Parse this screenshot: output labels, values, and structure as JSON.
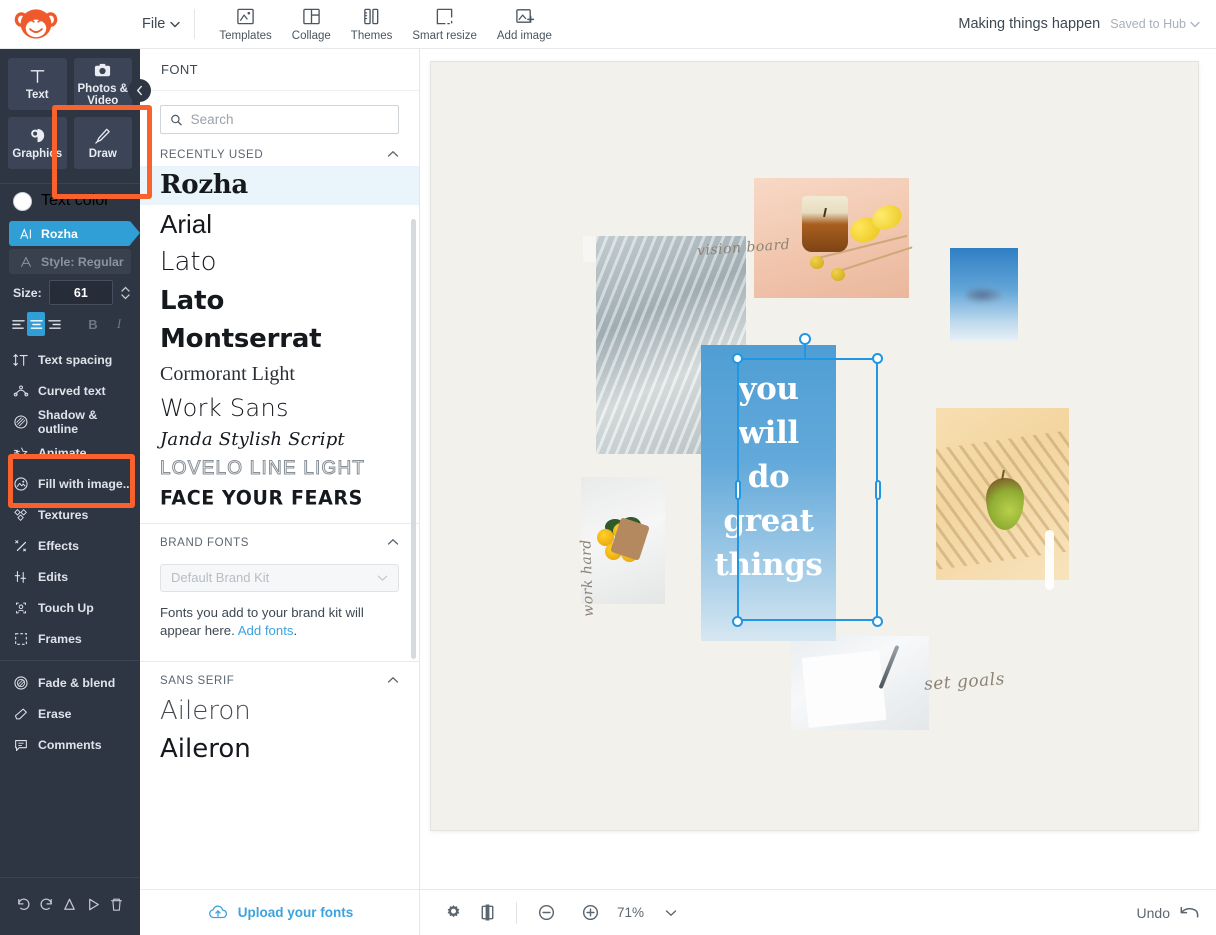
{
  "topbar": {
    "logo": "picmonkey-monkey-logo",
    "file_menu": "File",
    "tools": [
      {
        "label": "Templates",
        "icon": "templates-icon"
      },
      {
        "label": "Collage",
        "icon": "collage-icon"
      },
      {
        "label": "Themes",
        "icon": "themes-icon"
      },
      {
        "label": "Smart resize",
        "icon": "smart-resize-icon"
      },
      {
        "label": "Add image",
        "icon": "add-image-icon"
      }
    ],
    "doc_title": "Making things happen",
    "save_status": "Saved to Hub"
  },
  "rail": {
    "cards": [
      {
        "label": "Text",
        "icon": "text-icon"
      },
      {
        "label": "Photos & Video",
        "icon": "camera-icon"
      },
      {
        "label": "Graphics",
        "icon": "graphics-icon"
      },
      {
        "label": "Draw",
        "icon": "draw-pen-icon"
      }
    ],
    "text_color_label": "Text color",
    "text_color_value": "#ffffff",
    "font_pill": "Rozha",
    "style_pill": "Style: Regular",
    "size_label": "Size:",
    "size_value": "61",
    "align_selected": "center",
    "bold_label": "B",
    "italic_label": "I",
    "menu": [
      {
        "label": "Text spacing",
        "icon": "text-spacing-icon"
      },
      {
        "label": "Curved text",
        "icon": "curved-text-icon"
      },
      {
        "label": "Shadow & outline",
        "icon": "shadow-outline-icon"
      },
      {
        "label": "Animate",
        "icon": "animate-star-icon"
      },
      {
        "label": "Fill with image...",
        "icon": "fill-with-image-icon"
      },
      {
        "label": "Textures",
        "icon": "textures-icon"
      },
      {
        "label": "Effects",
        "icon": "effects-wand-icon"
      },
      {
        "label": "Edits",
        "icon": "edits-sliders-icon"
      },
      {
        "label": "Touch Up",
        "icon": "touch-up-face-icon"
      },
      {
        "label": "Frames",
        "icon": "frames-icon"
      }
    ],
    "menu2": [
      {
        "label": "Fade & blend",
        "icon": "fade-blend-icon"
      },
      {
        "label": "Erase",
        "icon": "eraser-icon"
      },
      {
        "label": "Comments",
        "icon": "comments-icon"
      }
    ],
    "bottom_icons": [
      {
        "icon": "undo-icon"
      },
      {
        "icon": "redo-icon"
      },
      {
        "icon": "flip-icon"
      },
      {
        "icon": "play-icon"
      },
      {
        "icon": "trash-icon"
      }
    ],
    "collapse_icon": "chevron-left-icon",
    "highlight_color": "#f9622c"
  },
  "panel": {
    "title": "FONT",
    "search_placeholder": "Search",
    "search_value": "",
    "search_icon": "search-icon",
    "sections": [
      {
        "heading": "RECENTLY USED",
        "fonts": [
          {
            "name": "Rozha",
            "selected": true
          },
          {
            "name": "Arial",
            "selected": false
          },
          {
            "name": "Lato",
            "selected": false
          },
          {
            "name": "Lato",
            "selected": false
          },
          {
            "name": "Montserrat",
            "selected": false
          },
          {
            "name": "Cormorant Light",
            "selected": false
          },
          {
            "name": "Work Sans",
            "selected": false
          },
          {
            "name": "Janda Stylish Script",
            "selected": false
          },
          {
            "name": "LOVELO LINE LIGHT",
            "selected": false
          },
          {
            "name": "FACE YOUR FEARS",
            "selected": false
          }
        ]
      },
      {
        "heading": "BRAND FONTS",
        "select_placeholder": "Default Brand Kit",
        "note_before": "Fonts you add to your brand kit will appear here. ",
        "note_link": "Add fonts",
        "note_after": "."
      },
      {
        "heading": "SANS SERIF",
        "fonts": [
          {
            "name": "Aileron",
            "selected": false
          },
          {
            "name": "Aileron",
            "selected": false
          }
        ]
      }
    ],
    "upload_label": "Upload your fonts",
    "upload_icon": "cloud-upload-icon"
  },
  "canvas": {
    "background": "#f2f1ec",
    "selected_text": [
      "you",
      "will",
      "do",
      "great",
      "things"
    ],
    "annotations": [
      {
        "text": "vision board"
      },
      {
        "text": "work hard"
      },
      {
        "text": "set goals"
      }
    ],
    "selection_color": "#2196e3"
  },
  "bottombar": {
    "settings_icon": "gear-icon",
    "panels_icon": "split-view-icon",
    "zoom_out_icon": "zoom-out-icon",
    "zoom_in_icon": "zoom-in-icon",
    "zoom_value": "71%",
    "zoom_chevron": "chevron-down-icon",
    "undo_label": "Undo",
    "undo_icon": "undo-arrow-icon"
  }
}
